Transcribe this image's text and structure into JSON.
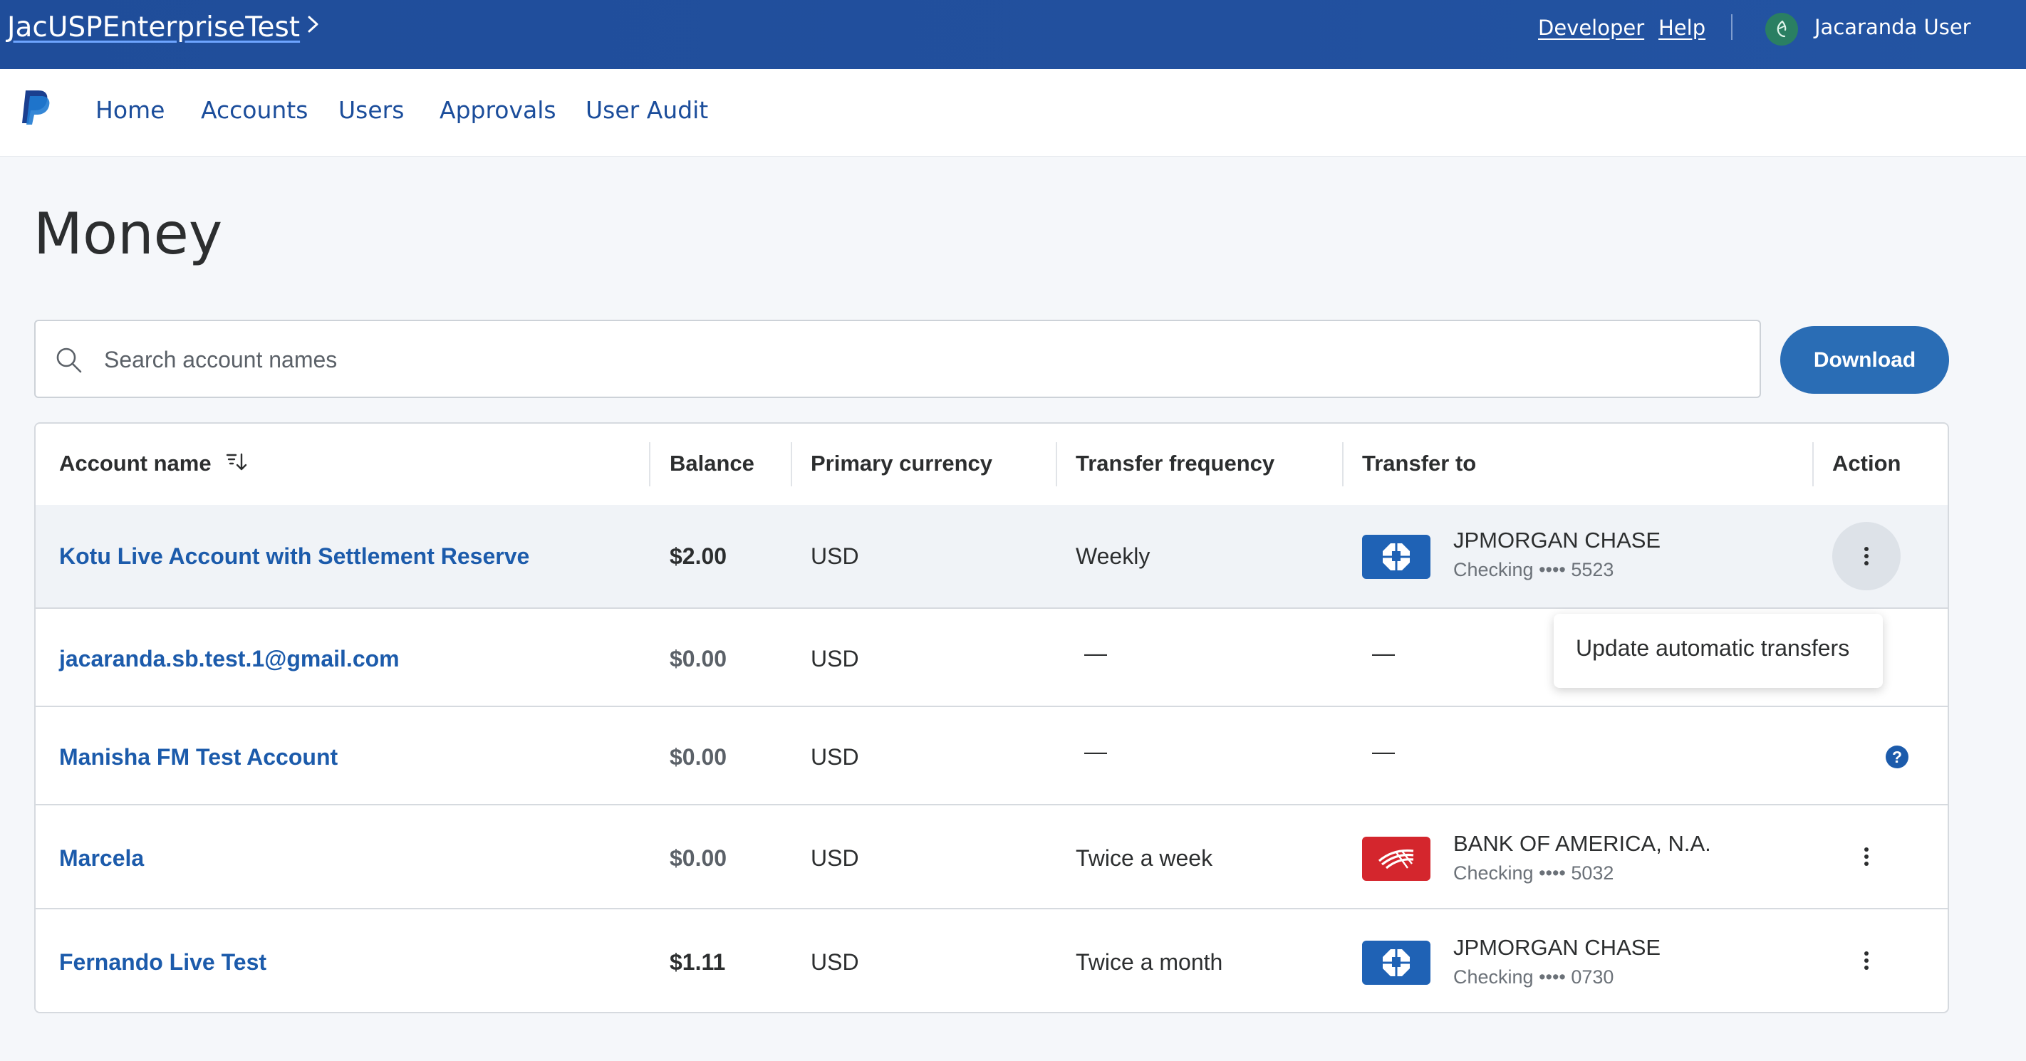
{
  "topbar": {
    "org_name": "JacUSPEnterpriseTest",
    "developer_link": "Developer",
    "help_link": "Help",
    "user_name": "Jacaranda User"
  },
  "nav": {
    "items": [
      "Home",
      "Accounts",
      "Users",
      "Approvals",
      "User Audit"
    ]
  },
  "page": {
    "title": "Money"
  },
  "search": {
    "placeholder": "Search account names",
    "value": ""
  },
  "download_label": "Download",
  "table": {
    "headers": {
      "account_name": "Account name",
      "balance": "Balance",
      "primary_currency": "Primary currency",
      "transfer_frequency": "Transfer frequency",
      "transfer_to": "Transfer to",
      "action": "Action"
    },
    "rows": [
      {
        "account_name": "Kotu Live Account with Settlement Reserve",
        "balance": "$2.00",
        "currency": "USD",
        "frequency": "Weekly",
        "bank_name": "JPMORGAN CHASE",
        "bank_account": "Checking •••• 5523",
        "bank_logo": "chase-logo",
        "action": "more-icon"
      },
      {
        "account_name": "jacaranda.sb.test.1@gmail.com",
        "balance": "$0.00",
        "currency": "USD",
        "frequency": "—",
        "transfer_to": "—"
      },
      {
        "account_name": "Manisha FM Test Account",
        "balance": "$0.00",
        "currency": "USD",
        "frequency": "—",
        "transfer_to": "—",
        "action": "help-icon"
      },
      {
        "account_name": "Marcela",
        "balance": "$0.00",
        "currency": "USD",
        "frequency": "Twice a week",
        "bank_name": "BANK OF AMERICA, N.A.",
        "bank_account": "Checking •••• 5032",
        "bank_logo": "bank-of-america-logo",
        "action": "more-icon"
      },
      {
        "account_name": "Fernando Live Test",
        "balance": "$1.11",
        "currency": "USD",
        "frequency": "Twice a month",
        "bank_name": "JPMORGAN CHASE",
        "bank_account": "Checking •••• 0730",
        "bank_logo": "chase-logo",
        "action": "more-icon"
      }
    ]
  },
  "action_menu": {
    "items": [
      "Update automatic transfers"
    ]
  },
  "colors": {
    "topbar": "#1f4d9a",
    "link": "#1c5bab",
    "button": "#2a6db5",
    "chase": "#1f62b5",
    "boa": "#d4262d"
  }
}
